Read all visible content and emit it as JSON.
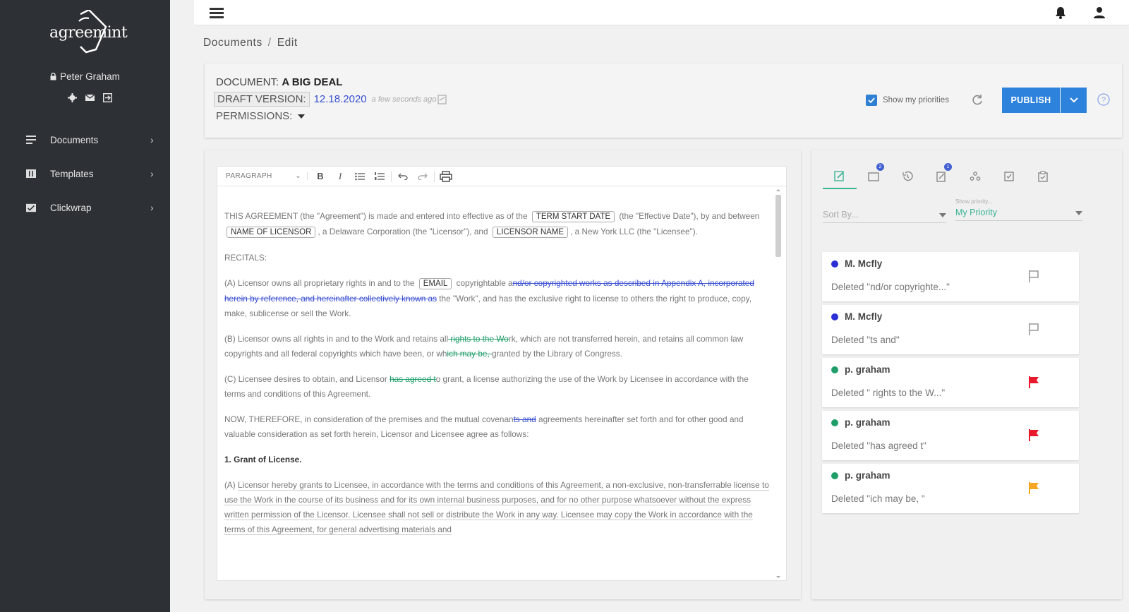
{
  "brand": {
    "name": "agreemint"
  },
  "user": {
    "name": "Peter Graham"
  },
  "sidebar": {
    "items": [
      {
        "label": "Documents",
        "icon": "documents-icon"
      },
      {
        "label": "Templates",
        "icon": "templates-icon"
      },
      {
        "label": "Clickwrap",
        "icon": "clickwrap-icon"
      }
    ]
  },
  "breadcrumb": {
    "root": "Documents",
    "current": "Edit",
    "separator": "/"
  },
  "document": {
    "title_prefix": "DOCUMENT:",
    "title": "A BIG DEAL",
    "draft_label": "DRAFT VERSION:",
    "draft_date": "12.18.2020",
    "draft_ago": "a few seconds ago",
    "permissions_label": "PERMISSIONS:"
  },
  "actions": {
    "show_priorities": "Show my priorities",
    "show_priorities_checked": true,
    "publish": "PUBLISH"
  },
  "editor": {
    "paragraph_select": "PARAGRAPH",
    "p1": {
      "a": "THIS AGREEMENT (the \"Agreement\") is made and entered into effective as of the",
      "tag1": "TERM START DATE",
      "b": "(the \"Effective Date\"), by and between",
      "tag2": "NAME OF LICENSOR",
      "c": ", a Delaware Corporation (the \"Licensor\"), and",
      "tag3": "LICENSOR NAME",
      "d": ", a New York LLC (the \"Licensee\")."
    },
    "recitals": "RECITALS:",
    "pA": {
      "a": "(A) Licensor owns all proprietary rights in and to the",
      "tag": "EMAIL",
      "b": "copyrightable a",
      "del": "nd/or copyrighted works as described in Appendix A, incorporated herein by reference, and hereinafter collectively known as",
      "c": " the \"Work\", and has the exclusive right to license to others the right to produce, copy, make, sublicense or sell the Work."
    },
    "pB": {
      "a": "(B) Licensor owns all rights in and to the Work and retains all",
      "del1": " rights to the Wo",
      "b": "rk, which are not transferred herein, and retains all common law copyrights and all federal copyrights which have been, or wh",
      "del2": "ich may be, ",
      "c": "granted by the Library of Congress."
    },
    "pC": {
      "a": "(C) Licensee desires to obtain, and Licensor ",
      "del": "has agreed t",
      "b": "o grant, a license authorizing the use of the Work by Licensee in accordance with the terms and conditions of this Agreement."
    },
    "pNow": {
      "a": "NOW, THEREFORE, in consideration of the premises and the mutual covenan",
      "del": "ts and",
      "b": " agreements hereinafter set forth and for other good and valuable consideration as set forth herein, Licensor and Licensee agree as follows:"
    },
    "heading1": "1. Grant of License.",
    "pGrant": {
      "a": "(A)",
      "b": "Licensor hereby grants to Licensee, in accordance with the terms and conditions of this Agreement, a non-exclusive, non-transferrable license to use the Work in the course of its business and for its own internal business purposes, and for no other purpose whatsoever without the express written permission of the Licensor. Licensee shall not sell or distribute the Work in any way. Licensee may copy the Work in accordance with the terms of this Agreement, for general advertising materials and"
    }
  },
  "panel": {
    "sort_placeholder": "Sort By...",
    "priority_label": "Show priority...",
    "priority_value": "My Priority",
    "tab_badges": [
      "",
      "2",
      "",
      "1",
      "",
      "",
      ""
    ],
    "changes": [
      {
        "author": "M. Mcfly",
        "desc": "Deleted \"nd/or copyrighte...\"",
        "dot_color": "#2b2fd6",
        "flag": "outline",
        "flag_color": "#999999"
      },
      {
        "author": "M. Mcfly",
        "desc": "Deleted \"ts and\"",
        "dot_color": "#2b2fd6",
        "flag": "outline",
        "flag_color": "#999999"
      },
      {
        "author": "p. graham",
        "desc": "Deleted \" rights to the W...\"",
        "dot_color": "#1f9e6a",
        "flag": "filled",
        "flag_color": "#e8192c"
      },
      {
        "author": "p. graham",
        "desc": "Deleted \"has agreed t\"",
        "dot_color": "#1f9e6a",
        "flag": "filled",
        "flag_color": "#e8192c"
      },
      {
        "author": "p. graham",
        "desc": "Deleted \"ich may be, \"",
        "dot_color": "#1f9e6a",
        "flag": "filled",
        "flag_color": "#f5a623"
      }
    ]
  },
  "colors": {
    "sidebar_bg": "#2d3135",
    "accent": "#2d82dc",
    "link_blue": "#3950d0",
    "green": "#3bb394"
  }
}
